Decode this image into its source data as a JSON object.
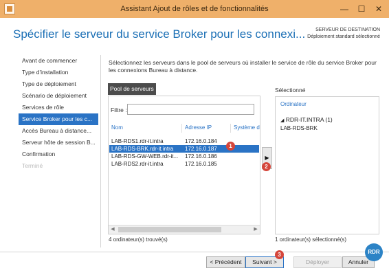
{
  "window": {
    "title": "Assistant Ajout de rôles et de fonctionnalités",
    "minimize_symbol": "—",
    "maximize_symbol": "☐",
    "close_symbol": "✕"
  },
  "header": {
    "title": "Spécifier le serveur du service Broker pour les connexi...",
    "destination_label": "SERVEUR DE DESTINATION",
    "destination_value": "Déploiement standard sélectionné"
  },
  "nav": {
    "items": [
      {
        "label": "Avant de commencer",
        "state": "normal"
      },
      {
        "label": "Type d'installation",
        "state": "normal"
      },
      {
        "label": "Type de déploiement",
        "state": "normal"
      },
      {
        "label": "Scénario de déploiement",
        "state": "normal"
      },
      {
        "label": "Services de rôle",
        "state": "normal"
      },
      {
        "label": "Service Broker pour les c...",
        "state": "active"
      },
      {
        "label": "Accès Bureau à distance...",
        "state": "normal"
      },
      {
        "label": "Serveur hôte de session B...",
        "state": "normal"
      },
      {
        "label": "Confirmation",
        "state": "normal"
      },
      {
        "label": "Terminé",
        "state": "disabled"
      }
    ]
  },
  "main": {
    "description": "Sélectionnez les serveurs dans le pool de serveurs où installer le service de rôle du service Broker pour les connexions Bureau à distance.",
    "pool_tab": "Pool de serveurs",
    "filter_label": "Filtre :",
    "filter_value": "",
    "columns": [
      "Nom",
      "Adresse IP",
      "Système d"
    ],
    "rows": [
      {
        "name": "LAB-RDS1.rdr-it.intra",
        "ip": "172.16.0.184",
        "selected": false
      },
      {
        "name": "LAB-RDS-BRK.rdr-it.intra",
        "ip": "172.16.0.187",
        "selected": true
      },
      {
        "name": "LAB-RDS-GW-WEB.rdr-it...",
        "ip": "172.16.0.186",
        "selected": false
      },
      {
        "name": "LAB-RDS2.rdr-it.intra",
        "ip": "172.16.0.185",
        "selected": false
      }
    ],
    "found_count": "4 ordinateur(s) trouvé(s)",
    "move_button": "▶",
    "selected_label": "Sélectionné",
    "selected_header": "Ordinateur",
    "selected_group": "RDR-IT.INTRA (1)",
    "selected_items": [
      "LAB-RDS-BRK"
    ],
    "selected_count": "1 ordinateur(s) sélectionné(s)"
  },
  "footer": {
    "previous": "< Précédent",
    "next": "Suivant >",
    "deploy": "Déployer",
    "cancel": "Annuler"
  },
  "annotations": {
    "one": "1",
    "two": "2",
    "three": "3"
  },
  "logo": {
    "text": "RDR"
  },
  "colors": {
    "titlebar": "#efb06a",
    "accent": "#2a73c5",
    "heading": "#1b6fb5",
    "badge": "#d5463b"
  }
}
